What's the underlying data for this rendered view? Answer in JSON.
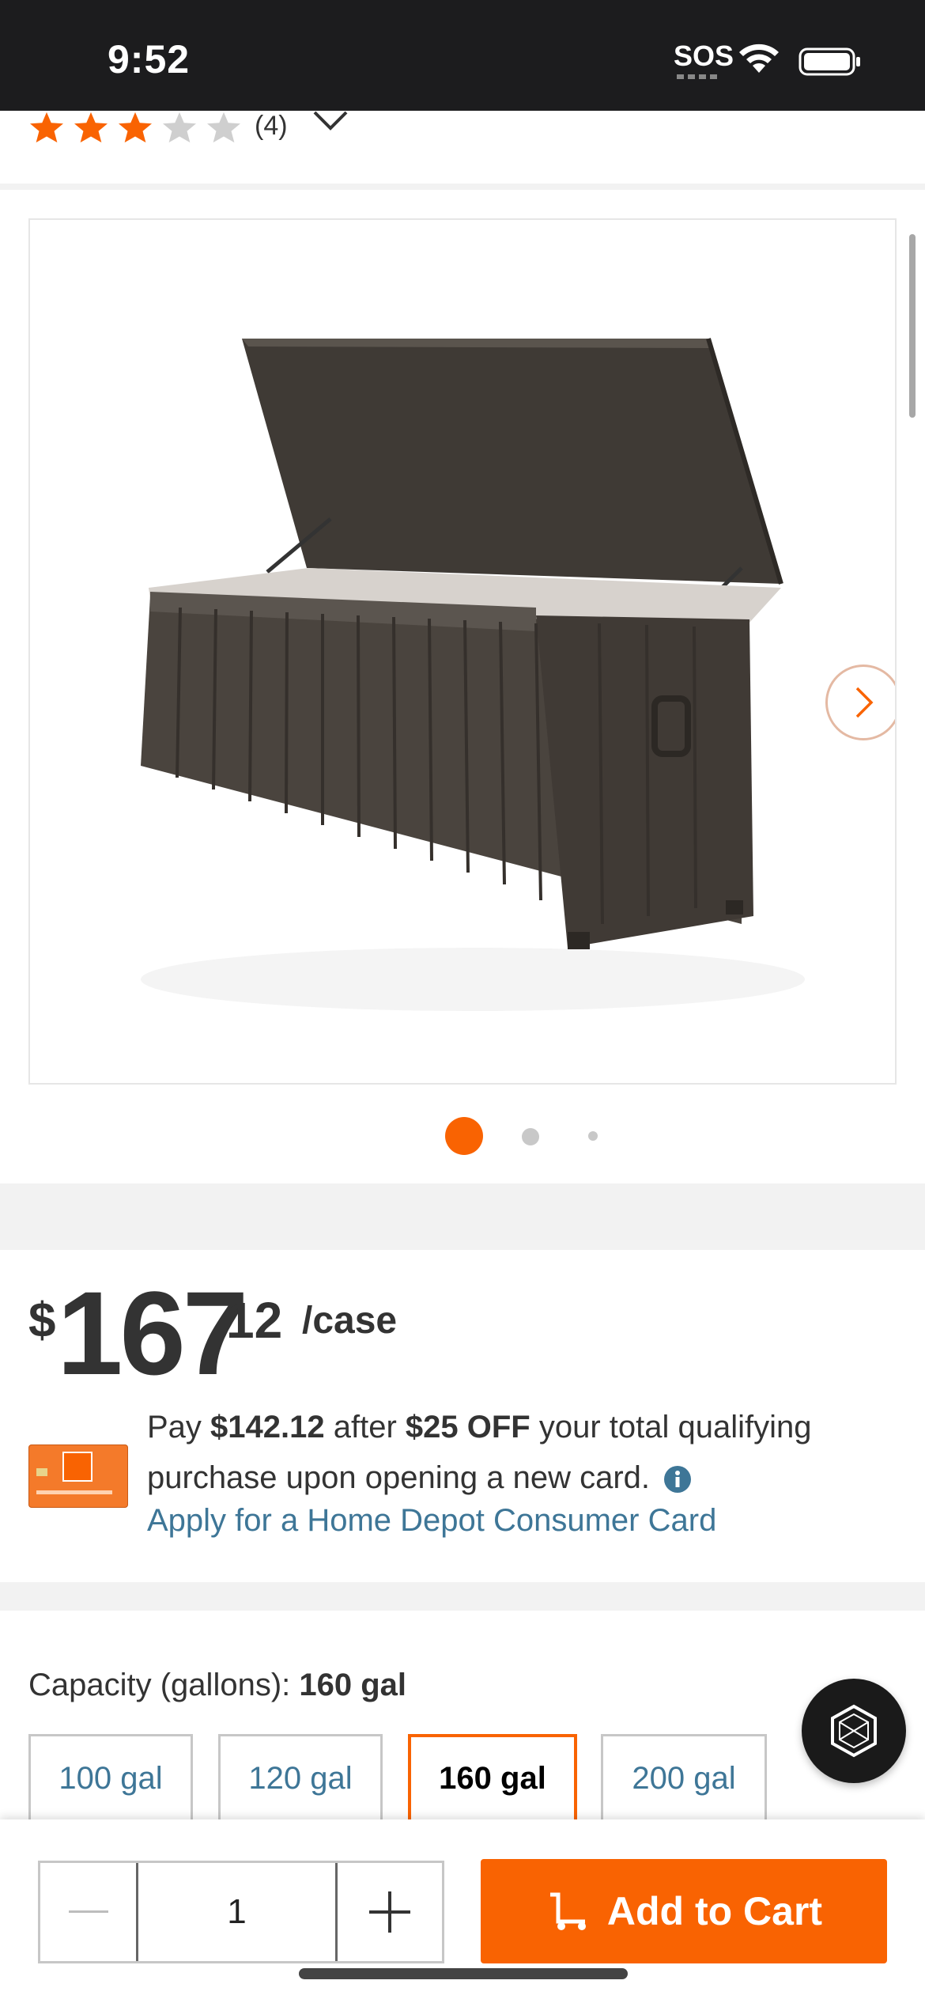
{
  "status_bar": {
    "time": "9:52",
    "sos": "SOS"
  },
  "rating": {
    "stars_filled": 3,
    "stars_total": 5,
    "review_count": "(4)"
  },
  "gallery": {
    "image_count": 3,
    "active_index": 0
  },
  "price": {
    "dollar_sign": "$",
    "whole": "167",
    "cents": "12",
    "unit": "/case"
  },
  "card_offer": {
    "pay_prefix": "Pay ",
    "pay_amount": "$142.12",
    "after": " after ",
    "discount": "$25 OFF",
    "rest_line": " your total qualifying purchase upon opening a new card.",
    "apply_link": "Apply for a Home Depot Consumer Card"
  },
  "capacity": {
    "label": "Capacity (gallons): ",
    "selected_value": "160 gal",
    "options": [
      "100 gal",
      "120 gal",
      "160 gal",
      "200 gal"
    ]
  },
  "cart": {
    "quantity": "1",
    "add_label": "Add to Cart"
  },
  "colors": {
    "brand_orange": "#f96302",
    "link_blue": "#3e7697"
  }
}
